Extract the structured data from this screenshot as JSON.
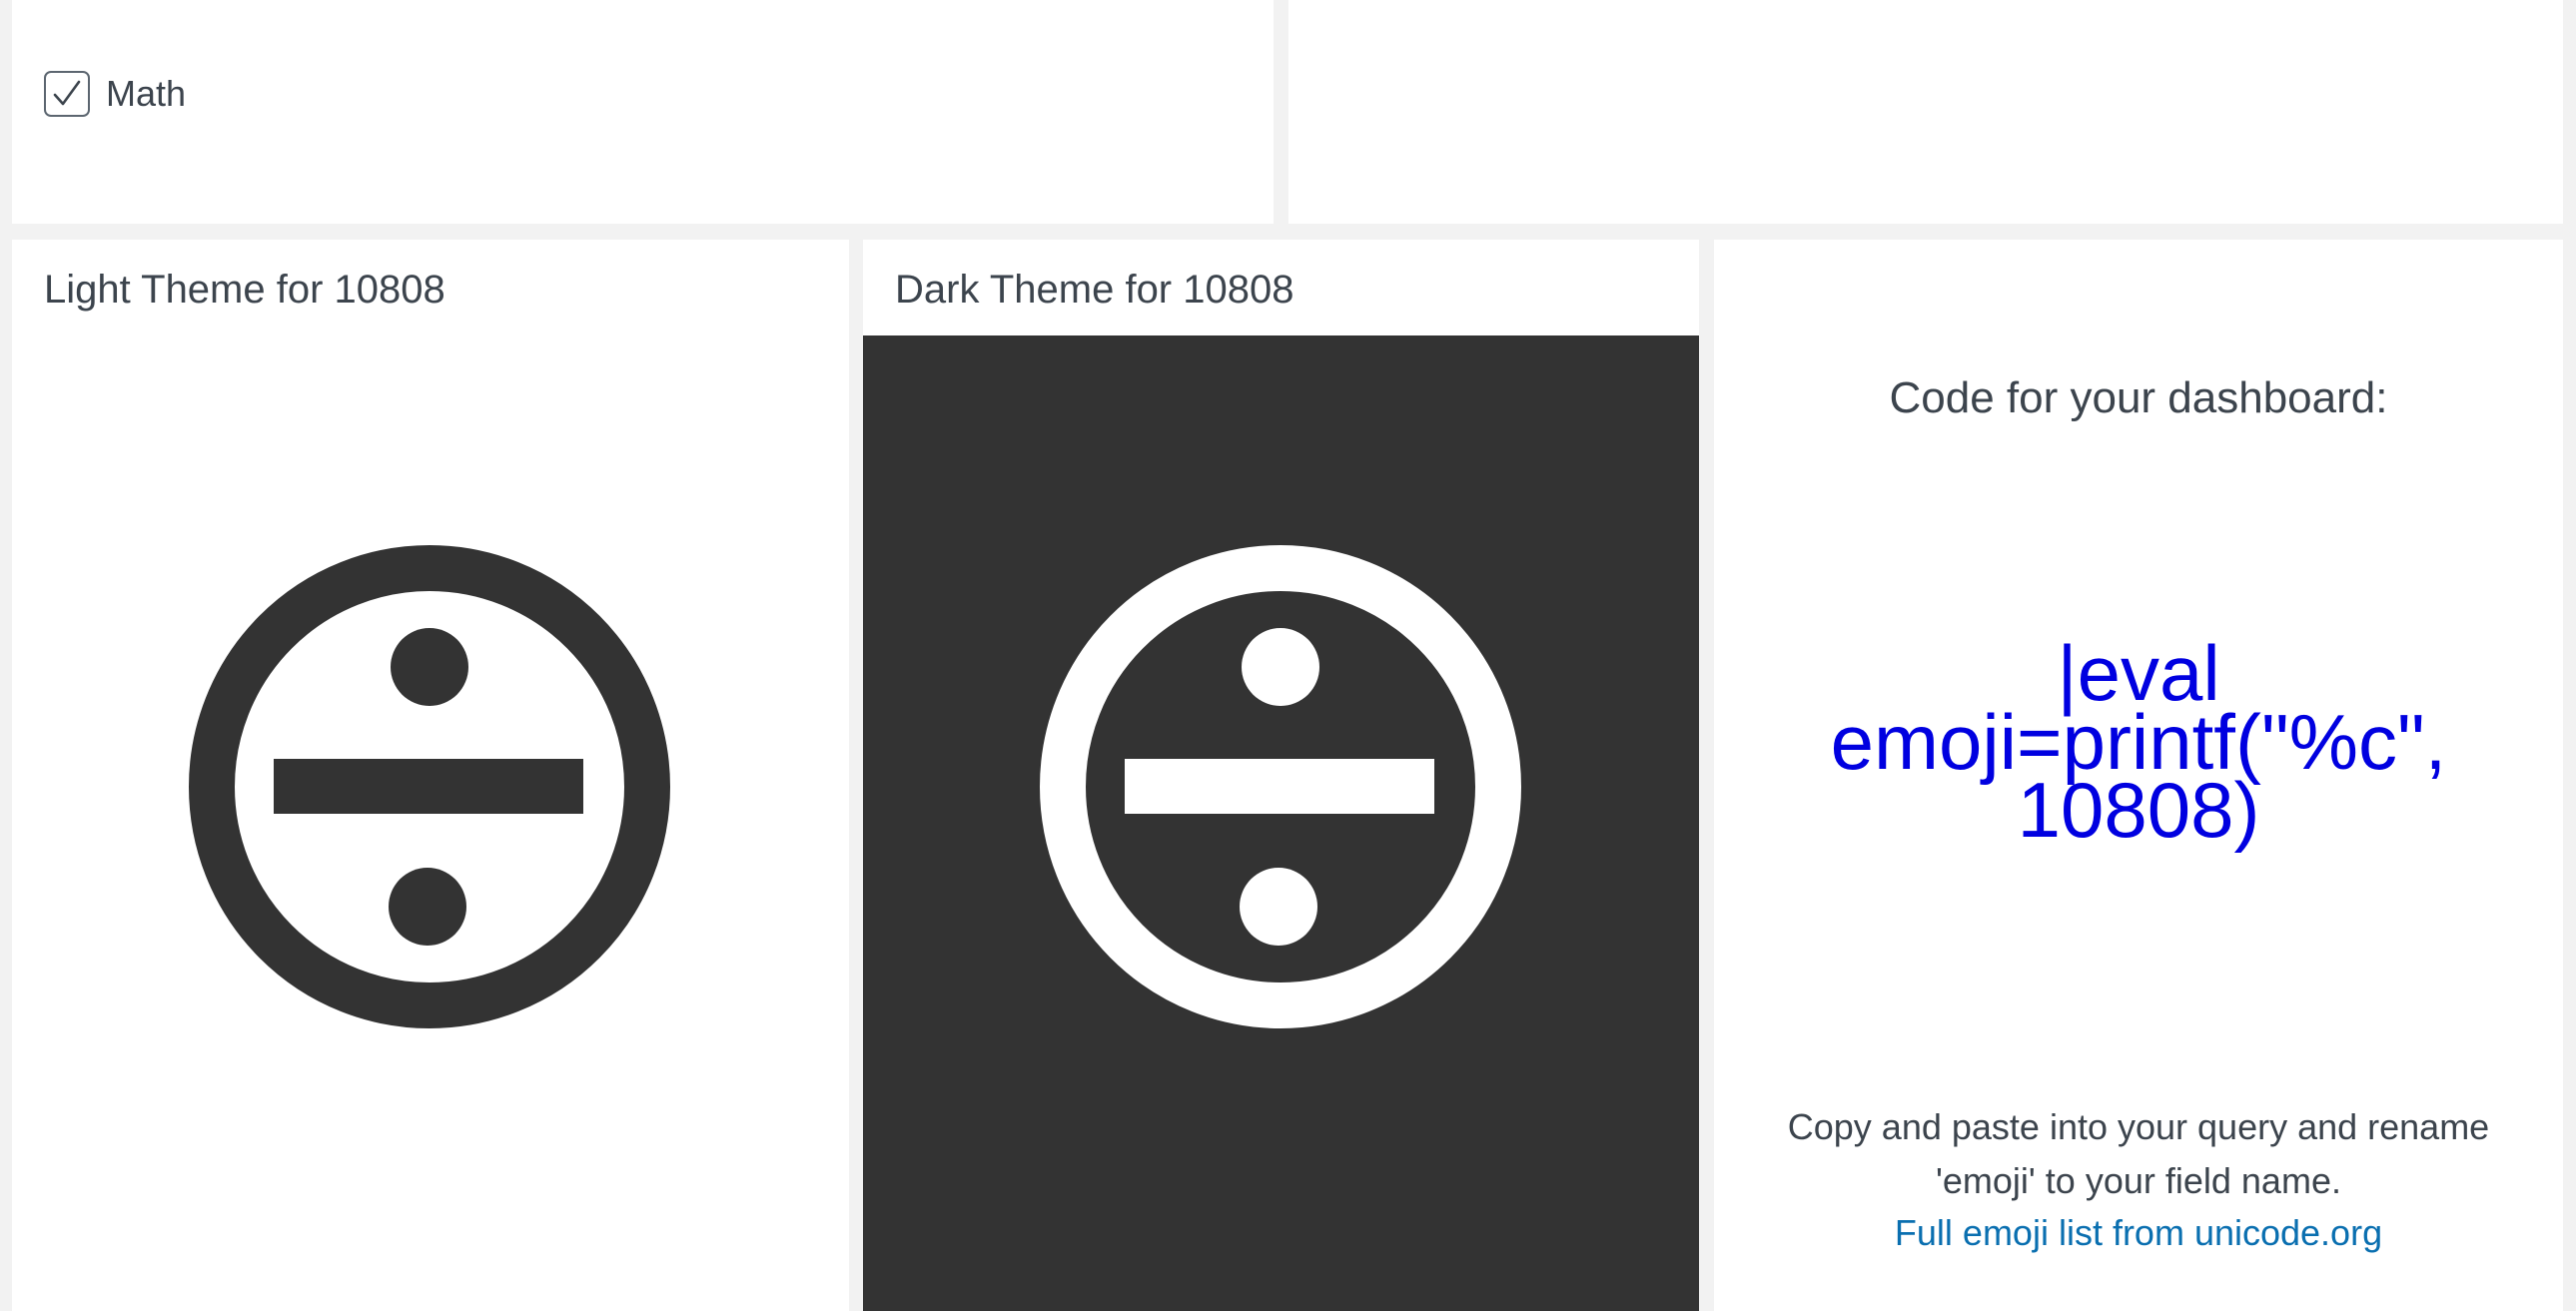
{
  "filter": {
    "checkbox_label": "Math",
    "checked": true
  },
  "light_panel": {
    "title": "Light Theme for 10808",
    "icon": "circled-division-sign-icon",
    "background": "#ffffff",
    "foreground": "#333333"
  },
  "dark_panel": {
    "title": "Dark Theme for 10808",
    "icon": "circled-division-sign-icon",
    "background": "#333333",
    "foreground": "#ffffff"
  },
  "code_panel": {
    "heading": "Code for your dashboard:",
    "snippet_lines": [
      "|eval",
      "emoji=printf(\"%c\",",
      "10808)"
    ],
    "snippet_color": "#0000e0",
    "instructions": "Copy and paste into your query and rename 'emoji' to your field name.",
    "link_text": "Full emoji list from unicode.org",
    "link_color": "#0a6fb0"
  }
}
